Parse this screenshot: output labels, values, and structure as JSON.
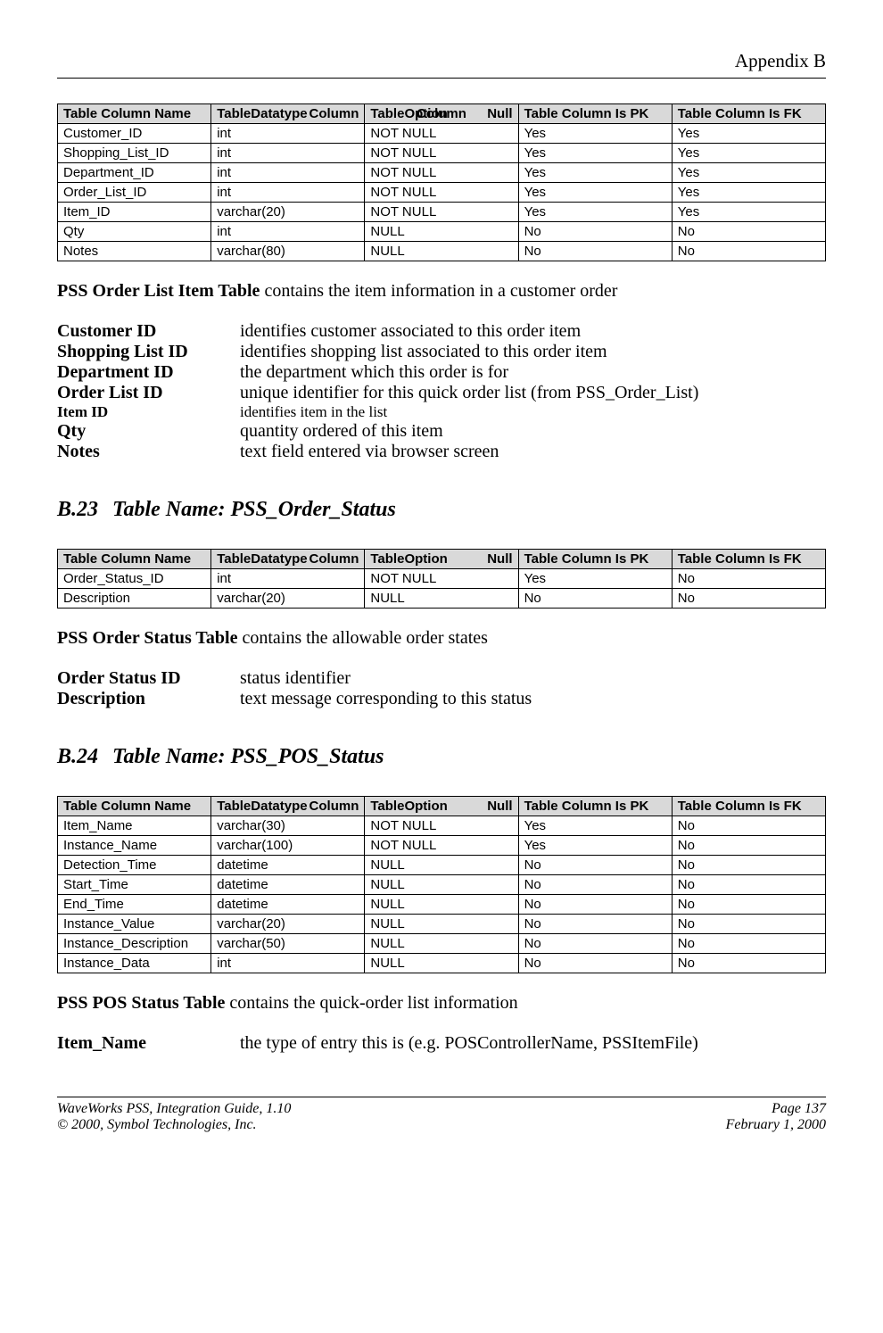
{
  "header": {
    "appendix": "Appendix B"
  },
  "tableHeaders": {
    "name": "Table Column Name",
    "datatype_l": "Table",
    "datatype_r": "Column",
    "datatype_b": "Datatype",
    "null_l": "Table",
    "null_m": "Column",
    "null_r": "Null",
    "null_b": "Option",
    "pk": "Table Column Is PK",
    "fk": "Table Column Is FK"
  },
  "table1": {
    "rows": [
      {
        "name": "Customer_ID",
        "dt": "int",
        "null": "NOT NULL",
        "pk": "Yes",
        "fk": "Yes"
      },
      {
        "name": "Shopping_List_ID",
        "dt": "int",
        "null": "NOT NULL",
        "pk": "Yes",
        "fk": "Yes"
      },
      {
        "name": "Department_ID",
        "dt": "int",
        "null": "NOT NULL",
        "pk": "Yes",
        "fk": "Yes"
      },
      {
        "name": "Order_List_ID",
        "dt": "int",
        "null": "NOT NULL",
        "pk": "Yes",
        "fk": "Yes"
      },
      {
        "name": "Item_ID",
        "dt": "varchar(20)",
        "null": "NOT NULL",
        "pk": "Yes",
        "fk": "Yes"
      },
      {
        "name": "Qty",
        "dt": "int",
        "null": "NULL",
        "pk": "No",
        "fk": "No"
      },
      {
        "name": "Notes",
        "dt": "varchar(80)",
        "null": "NULL",
        "pk": "No",
        "fk": "No"
      }
    ]
  },
  "intro1": {
    "bold": "PSS Order List Item Table",
    "rest": " contains the item information in a customer order"
  },
  "defs1": [
    {
      "term": "Customer ID",
      "def": "identifies customer associated to this order item"
    },
    {
      "term": "Shopping List ID",
      "def": "identifies shopping list associated to this order item"
    },
    {
      "term": "Department ID",
      "def": "the department which this order is for"
    },
    {
      "term": "Order List ID",
      "def": "unique identifier for this quick order list (from PSS_Order_List)"
    },
    {
      "term": "Item ID",
      "def": "identifies item in the list",
      "small": true
    },
    {
      "term": "Qty",
      "def": "quantity ordered of this item"
    },
    {
      "term": "Notes",
      "def": "text field entered via browser screen"
    }
  ],
  "section23": {
    "num": "B.23",
    "title": "Table Name: PSS_Order_Status"
  },
  "table2": {
    "rows": [
      {
        "name": "Order_Status_ID",
        "dt": "int",
        "null": "NOT NULL",
        "pk": "Yes",
        "fk": "No"
      },
      {
        "name": "Description",
        "dt": "varchar(20)",
        "null": "NULL",
        "pk": "No",
        "fk": "No"
      }
    ]
  },
  "intro2": {
    "bold": "PSS Order Status Table",
    "rest": " contains the allowable order states"
  },
  "defs2": [
    {
      "term": "Order Status ID",
      "def": "status identifier"
    },
    {
      "term": "Description",
      "def": "text message corresponding to this status"
    }
  ],
  "section24": {
    "num": "B.24",
    "title": "Table Name: PSS_POS_Status"
  },
  "table3": {
    "rows": [
      {
        "name": "Item_Name",
        "dt": "varchar(30)",
        "null": "NOT NULL",
        "pk": "Yes",
        "fk": "No"
      },
      {
        "name": "Instance_Name",
        "dt": "varchar(100)",
        "null": "NOT NULL",
        "pk": "Yes",
        "fk": "No"
      },
      {
        "name": "Detection_Time",
        "dt": "datetime",
        "null": "NULL",
        "pk": "No",
        "fk": "No"
      },
      {
        "name": "Start_Time",
        "dt": "datetime",
        "null": "NULL",
        "pk": "No",
        "fk": "No"
      },
      {
        "name": "End_Time",
        "dt": "datetime",
        "null": "NULL",
        "pk": "No",
        "fk": "No"
      },
      {
        "name": "Instance_Value",
        "dt": "varchar(20)",
        "null": "NULL",
        "pk": "No",
        "fk": "No"
      },
      {
        "name": "Instance_Description",
        "dt": "varchar(50)",
        "null": "NULL",
        "pk": "No",
        "fk": "No"
      },
      {
        "name": "Instance_Data",
        "dt": "int",
        "null": "NULL",
        "pk": "No",
        "fk": "No"
      }
    ]
  },
  "intro3": {
    "bold": "PSS POS Status Table",
    "rest": " contains the quick-order list information"
  },
  "defs3": [
    {
      "term": "Item_Name",
      "def": "the type of entry this is (e.g. POSControllerName, PSSItemFile)"
    }
  ],
  "footer": {
    "left1": "WaveWorks PSS, Integration Guide, 1.10",
    "right1": "Page 137",
    "left2": "© 2000, Symbol Technologies, Inc.",
    "right2": "February 1, 2000"
  }
}
